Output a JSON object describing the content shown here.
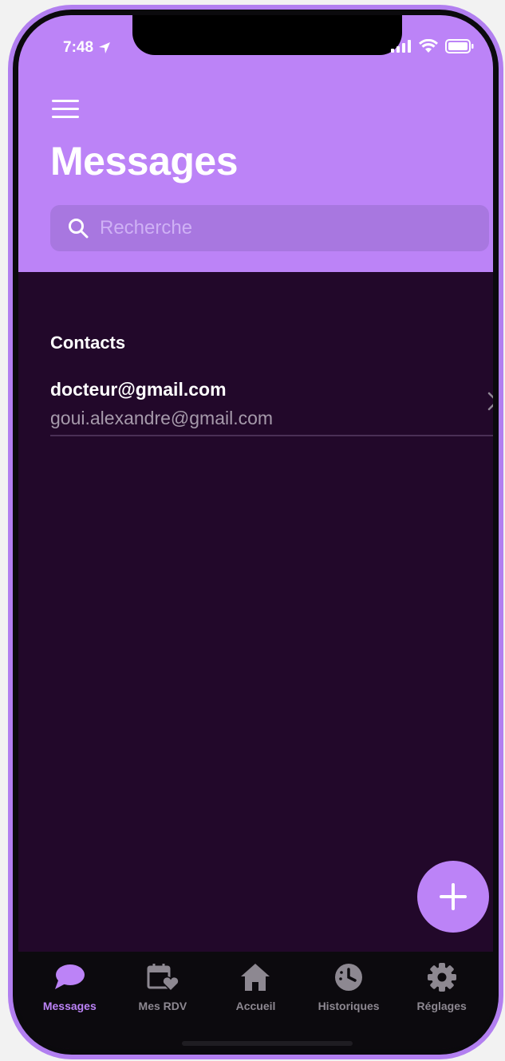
{
  "status_bar": {
    "time": "7:48",
    "location_icon": "location-arrow-icon",
    "signal_icon": "cellular-signal-icon",
    "wifi_icon": "wifi-icon",
    "battery_icon": "battery-icon"
  },
  "header": {
    "menu_icon": "hamburger-menu-icon",
    "title": "Messages"
  },
  "search": {
    "placeholder": "Recherche",
    "value": "",
    "icon": "search-icon"
  },
  "contacts": {
    "section_label": "Contacts",
    "items": [
      {
        "name": "docteur@gmail.com",
        "sub": "goui.alexandre@gmail.com"
      }
    ]
  },
  "fab": {
    "icon": "plus-icon"
  },
  "tabbar": {
    "active": "Messages",
    "tabs": [
      {
        "label": "Messages",
        "icon": "chat-bubble-icon"
      },
      {
        "label": "Mes RDV",
        "icon": "calendar-heart-icon"
      },
      {
        "label": "Accueil",
        "icon": "home-icon"
      },
      {
        "label": "Historiques",
        "icon": "history-clock-icon"
      },
      {
        "label": "Réglages",
        "icon": "gear-icon"
      }
    ]
  },
  "colors": {
    "accent": "#bc83f7",
    "background": "#22082a",
    "tabbar": "#0c0a0e",
    "inactive_tab": "#8d8891"
  }
}
